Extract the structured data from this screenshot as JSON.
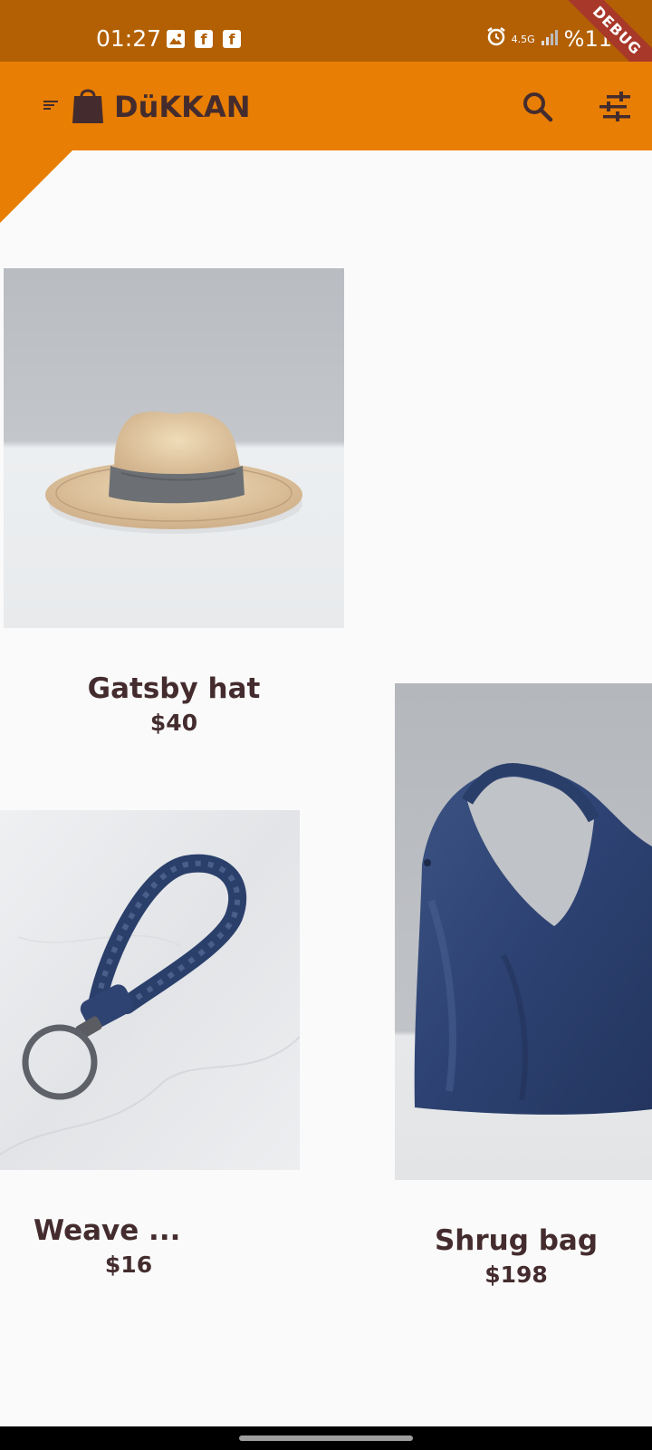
{
  "status_bar": {
    "time": "01:27",
    "network": "4.5G",
    "battery": "%11",
    "notification_icons": [
      "gallery-icon",
      "facebook-icon",
      "facebook-icon"
    ],
    "debug_label": "DEBUG"
  },
  "app_bar": {
    "title": "DüKKAN",
    "actions": [
      "search-icon",
      "tune-icon"
    ]
  },
  "products": [
    {
      "name": "Gatsby hat",
      "price": "$40"
    },
    {
      "name": "Weave ...",
      "price": "$16"
    },
    {
      "name": "Shrug bag",
      "price": "$198"
    }
  ],
  "colors": {
    "status_bar": "#b26003",
    "app_bar": "#e87e04",
    "text": "#442c2e",
    "background": "#fafafa"
  }
}
